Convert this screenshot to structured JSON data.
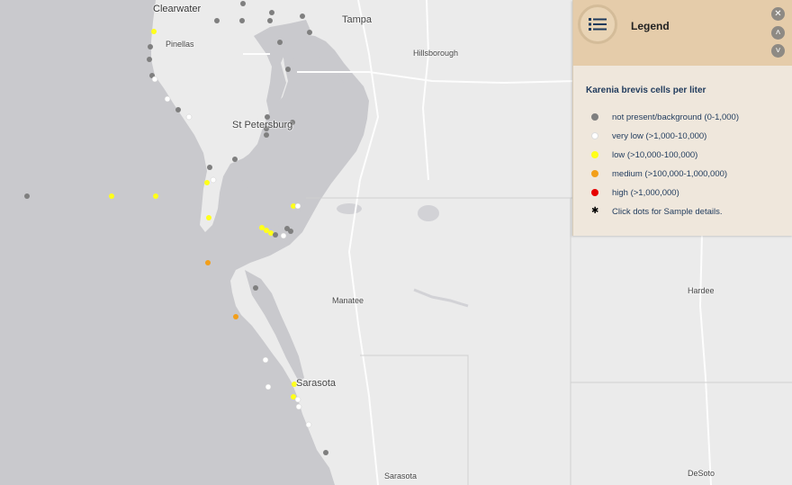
{
  "map": {
    "water_color": "#c9c9cd",
    "land_color": "#ebebeb",
    "places": [
      {
        "name": "Clearwater",
        "size": "big"
      },
      {
        "name": "Pinellas",
        "size": "small"
      },
      {
        "name": "Tampa",
        "size": "big"
      },
      {
        "name": "Hillsborough",
        "size": "small"
      },
      {
        "name": "St Petersburg",
        "size": "big"
      },
      {
        "name": "Manatee",
        "size": "small"
      },
      {
        "name": "Hardee",
        "size": "small"
      },
      {
        "name": "Sarasota",
        "size": "big"
      },
      {
        "name": "Sarasota",
        "size": "small"
      },
      {
        "name": "DeSoto",
        "size": "small"
      }
    ],
    "sample_count": 58
  },
  "legend": {
    "title": "Legend",
    "subtitle": "Karenia brevis cells per liter",
    "icon": "list-icon",
    "close_icon": "close-icon",
    "up_icon": "chevron-up-icon",
    "down_icon": "chevron-down-icon",
    "items": [
      {
        "label": "not present/background (0-1,000)",
        "color": "#7f7f7f"
      },
      {
        "label": "very low (>1,000-10,000)",
        "color": "#ffffff"
      },
      {
        "label": "low (>10,000-100,000)",
        "color": "#ffff1a"
      },
      {
        "label": "medium (>100,000-1,000,000)",
        "color": "#f29f1a"
      },
      {
        "label": "high (>1,000,000)",
        "color": "#e60000"
      },
      {
        "label": "Click dots for Sample details.",
        "color": "#000000",
        "icon": "asterisk-icon"
      }
    ]
  }
}
